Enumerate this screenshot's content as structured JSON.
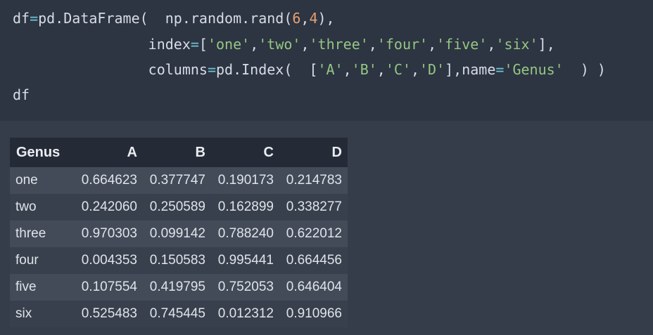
{
  "code": {
    "line1": {
      "a": "df",
      "eq": "=",
      "b": "pd.DataFrame(  np.random.rand(",
      "n1": "6",
      "comma": ",",
      "n2": "4",
      "c": "),"
    },
    "line2": {
      "indent": "                ",
      "kw": "index",
      "eq": "=",
      "open": "[",
      "items": [
        "'one'",
        "'two'",
        "'three'",
        "'four'",
        "'five'",
        "'six'"
      ],
      "sep": ",",
      "close": "],"
    },
    "line3": {
      "indent": "                ",
      "kw": "columns",
      "eq": "=",
      "a": "pd.Index(  [",
      "items": [
        "'A'",
        "'B'",
        "'C'",
        "'D'"
      ],
      "sep": ",",
      "b": "],name",
      "eq2": "=",
      "name": "'Genus'",
      "c": "  ) )"
    },
    "line4": "df"
  },
  "table": {
    "index_name": "Genus",
    "columns": [
      "A",
      "B",
      "C",
      "D"
    ],
    "rows": [
      {
        "label": "one",
        "values": [
          "0.664623",
          "0.377747",
          "0.190173",
          "0.214783"
        ]
      },
      {
        "label": "two",
        "values": [
          "0.242060",
          "0.250589",
          "0.162899",
          "0.338277"
        ]
      },
      {
        "label": "three",
        "values": [
          "0.970303",
          "0.099142",
          "0.788240",
          "0.622012"
        ]
      },
      {
        "label": "four",
        "values": [
          "0.004353",
          "0.150583",
          "0.995441",
          "0.664456"
        ]
      },
      {
        "label": "five",
        "values": [
          "0.107554",
          "0.419795",
          "0.752053",
          "0.646404"
        ]
      },
      {
        "label": "six",
        "values": [
          "0.525483",
          "0.745445",
          "0.012312",
          "0.910966"
        ]
      }
    ]
  },
  "colors": {
    "code_bg": "#2d3442",
    "output_bg": "#363d4a",
    "header_bg": "#252b36",
    "string": "#95c783",
    "number": "#e5a070",
    "operator": "#6fc5d6"
  }
}
